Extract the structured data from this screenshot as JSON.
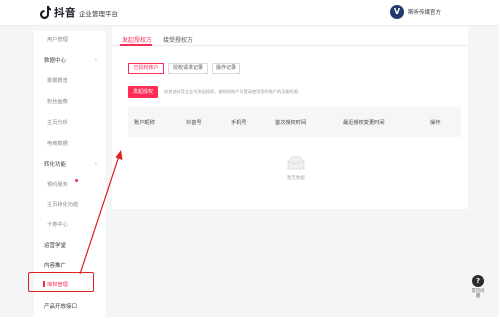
{
  "header": {
    "brand": "抖音",
    "platform": "企业管理平台",
    "avatar_letter": "V",
    "account_name": "斯听传媒官方"
  },
  "sidebar": {
    "items": [
      {
        "label": "用户管理",
        "kind": "sub"
      },
      {
        "label": "数据中心",
        "kind": "group",
        "expanded": true
      },
      {
        "label": "数据概览",
        "kind": "sub"
      },
      {
        "label": "粉丝画像",
        "kind": "sub"
      },
      {
        "label": "主页分析",
        "kind": "sub"
      },
      {
        "label": "电商数据",
        "kind": "sub"
      },
      {
        "label": "转化功能",
        "kind": "group",
        "expanded": true
      },
      {
        "label": "预约服务",
        "kind": "sub",
        "badge_dot": true
      },
      {
        "label": "主页转化功能",
        "kind": "sub"
      },
      {
        "label": "卡券中心",
        "kind": "sub"
      },
      {
        "label": "运营学堂",
        "kind": "top"
      },
      {
        "label": "内容推广",
        "kind": "top"
      },
      {
        "label": "授权管理",
        "kind": "active"
      },
      {
        "label": "产品开放接口",
        "kind": "top"
      }
    ]
  },
  "main": {
    "tabs": [
      {
        "label": "发起授权方",
        "active": true
      },
      {
        "label": "接受授权方",
        "active": false
      }
    ],
    "subtabs": [
      {
        "label": "已授权账户",
        "active": true
      },
      {
        "label": "授权请求记录",
        "active": false
      },
      {
        "label": "操作记录",
        "active": false
      }
    ],
    "primary_button": "发起授权",
    "hint": "向其他抖音企业号发起授权，被授权账户可登录使用您的账户的功能权限",
    "table": {
      "columns": [
        "账户昵称",
        "抖音号",
        "手机号",
        "首次授权时间",
        "最近授权变更时间",
        "操作"
      ],
      "rows": [],
      "empty_text": "暂无数据"
    }
  },
  "help": {
    "icon": "question-icon",
    "label": "常见问题"
  },
  "colors": {
    "accent": "#fe2c55",
    "annotation": "#e0201f"
  }
}
